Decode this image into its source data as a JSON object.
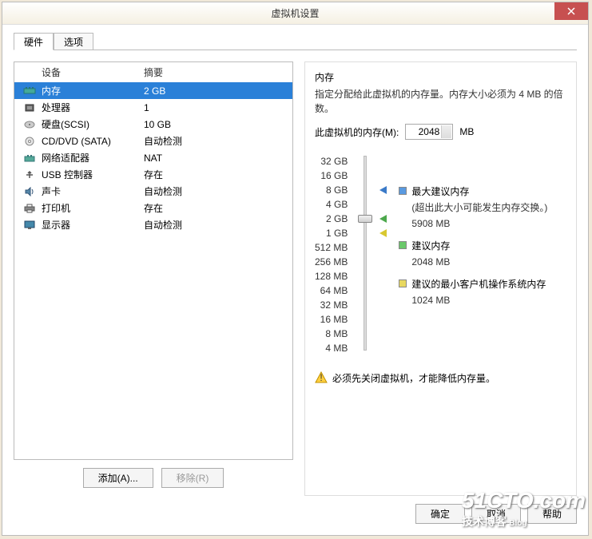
{
  "title": "虚拟机设置",
  "tabs": {
    "hardware": "硬件",
    "options": "选项"
  },
  "columns": {
    "device": "设备",
    "summary": "摘要"
  },
  "devices": [
    {
      "name": "内存",
      "summary": "2 GB",
      "icon": "memory"
    },
    {
      "name": "处理器",
      "summary": "1",
      "icon": "cpu"
    },
    {
      "name": "硬盘(SCSI)",
      "summary": "10 GB",
      "icon": "disk"
    },
    {
      "name": "CD/DVD (SATA)",
      "summary": "自动检测",
      "icon": "cd"
    },
    {
      "name": "网络适配器",
      "summary": "NAT",
      "icon": "net"
    },
    {
      "name": "USB 控制器",
      "summary": "存在",
      "icon": "usb"
    },
    {
      "name": "声卡",
      "summary": "自动检测",
      "icon": "sound"
    },
    {
      "name": "打印机",
      "summary": "存在",
      "icon": "printer"
    },
    {
      "name": "显示器",
      "summary": "自动检测",
      "icon": "display"
    }
  ],
  "buttons": {
    "add": "添加(A)...",
    "remove": "移除(R)",
    "ok": "确定",
    "cancel": "取消",
    "help": "帮助"
  },
  "memory": {
    "title": "内存",
    "desc": "指定分配给此虚拟机的内存量。内存大小必须为 4 MB 的倍数。",
    "label": "此虚拟机的内存(M):",
    "value": "2048",
    "unit": "MB",
    "ticks": [
      "32 GB",
      "16 GB",
      "8 GB",
      "4 GB",
      "2 GB",
      "1 GB",
      "512 MB",
      "256 MB",
      "128 MB",
      "64 MB",
      "32 MB",
      "16 MB",
      "8 MB",
      "4 MB"
    ],
    "legend": {
      "max": "最大建议内存",
      "max_note": "(超出此大小可能发生内存交换。)",
      "max_val": "5908 MB",
      "rec": "建议内存",
      "rec_val": "2048 MB",
      "min": "建议的最小客户机操作系统内存",
      "min_val": "1024 MB"
    },
    "warning": "必须先关闭虚拟机，才能降低内存量。"
  },
  "watermark": {
    "big": "51CTO.com",
    "small": "技术博客",
    "tag": "Blog"
  }
}
